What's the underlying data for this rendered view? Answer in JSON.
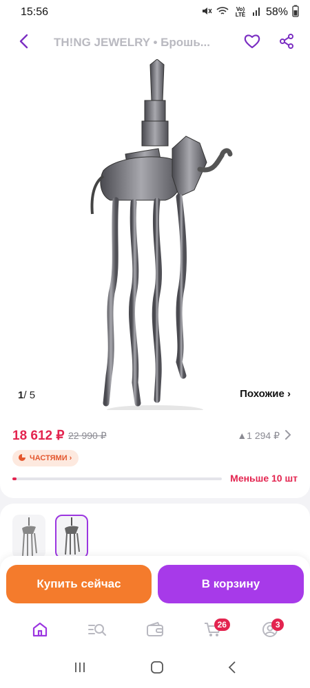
{
  "status_bar": {
    "time": "15:56",
    "network_label": "Vo) LTE",
    "battery": "58%",
    "icons": [
      "mute-icon",
      "wifi-icon",
      "signal-icon",
      "battery-icon"
    ]
  },
  "header": {
    "title": "TH!NG JEWELRY • Брошь...",
    "icons": [
      "back-icon",
      "heart-icon",
      "share-icon"
    ]
  },
  "gallery": {
    "current": "1",
    "separator": "/",
    "total": "5",
    "similar_label": "Похожие ›"
  },
  "pricing": {
    "price": "18 612 ₽",
    "old_price": "22 990 ₽",
    "bonus": "▲1 294 ₽",
    "installments_label": "ЧАСТЯМИ ›",
    "stock_label": "Меньше 10 шт",
    "stock_level": 0.02
  },
  "thumbnails": [
    {
      "name": "thumb-1",
      "selected": false
    },
    {
      "name": "thumb-2",
      "selected": true
    }
  ],
  "actions": {
    "buy_now": "Купить сейчас",
    "add_to_cart": "В корзину"
  },
  "bottom_nav": {
    "items": [
      "home-icon",
      "catalog-search-icon",
      "wallet-icon",
      "cart-icon",
      "profile-icon"
    ],
    "cart_badge": "26",
    "profile_badge": "3"
  },
  "colors": {
    "accent_purple": "#a73ae9",
    "accent_orange": "#f47b2c",
    "price_red": "#e3244f"
  }
}
